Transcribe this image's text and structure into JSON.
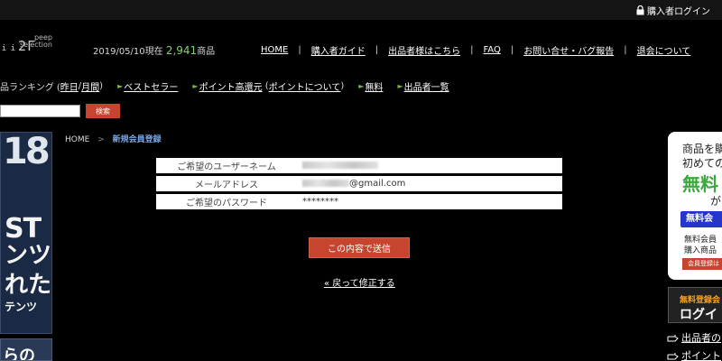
{
  "topbar": {
    "login_label": "購入者ログイン"
  },
  "header": {
    "logo_sub_1": "peep",
    "logo_sub_2": "selection",
    "logo_text": "ᵢᵢ2Γ",
    "date_prefix": "2019/05/10現在",
    "count": "2,941",
    "count_suffix": "商品",
    "nav": [
      "HOME",
      "購入者ガイド",
      "出品者様はこちら",
      "FAQ",
      "お問い合せ・バグ報告",
      "退会について"
    ]
  },
  "subnav": {
    "ranking_prefix": "品ランキング (",
    "yesterday": "昨日",
    "slash": " / ",
    "monthly": "月間",
    "close": ")",
    "items": [
      "ベストセラー",
      "ポイント高還元",
      "ポイントについて",
      "無料",
      "出品者一覧"
    ]
  },
  "search": {
    "value": "",
    "button": "検索"
  },
  "left_banner": {
    "line1": "18",
    "line2": "ST",
    "line3": "ンツ",
    "line4": "れた",
    "line5": "テンツ",
    "line6": "らの"
  },
  "breadcrumb": {
    "home": "HOME",
    "separator": ">",
    "current": "新規会員登録"
  },
  "form": {
    "rows": [
      {
        "label": "ご希望のユーザーネーム",
        "value": ""
      },
      {
        "label": "メールアドレス",
        "value": "@gmail.com"
      },
      {
        "label": "ご希望のパスワード",
        "value": "********"
      }
    ],
    "submit": "この内容で送信",
    "back": "« 戻って修正する"
  },
  "right_panel": {
    "line1": "商品を購",
    "line2": "初めての",
    "free": "無料",
    "ga": "が",
    "member_btn": "無料会",
    "small1": "無料会員",
    "small2": "購入商品",
    "red_bar": "会員登録は"
  },
  "right_login": {
    "top": "無料登録会",
    "main": "ログイ"
  },
  "right_links": [
    "出品者の",
    "ポイント"
  ]
}
